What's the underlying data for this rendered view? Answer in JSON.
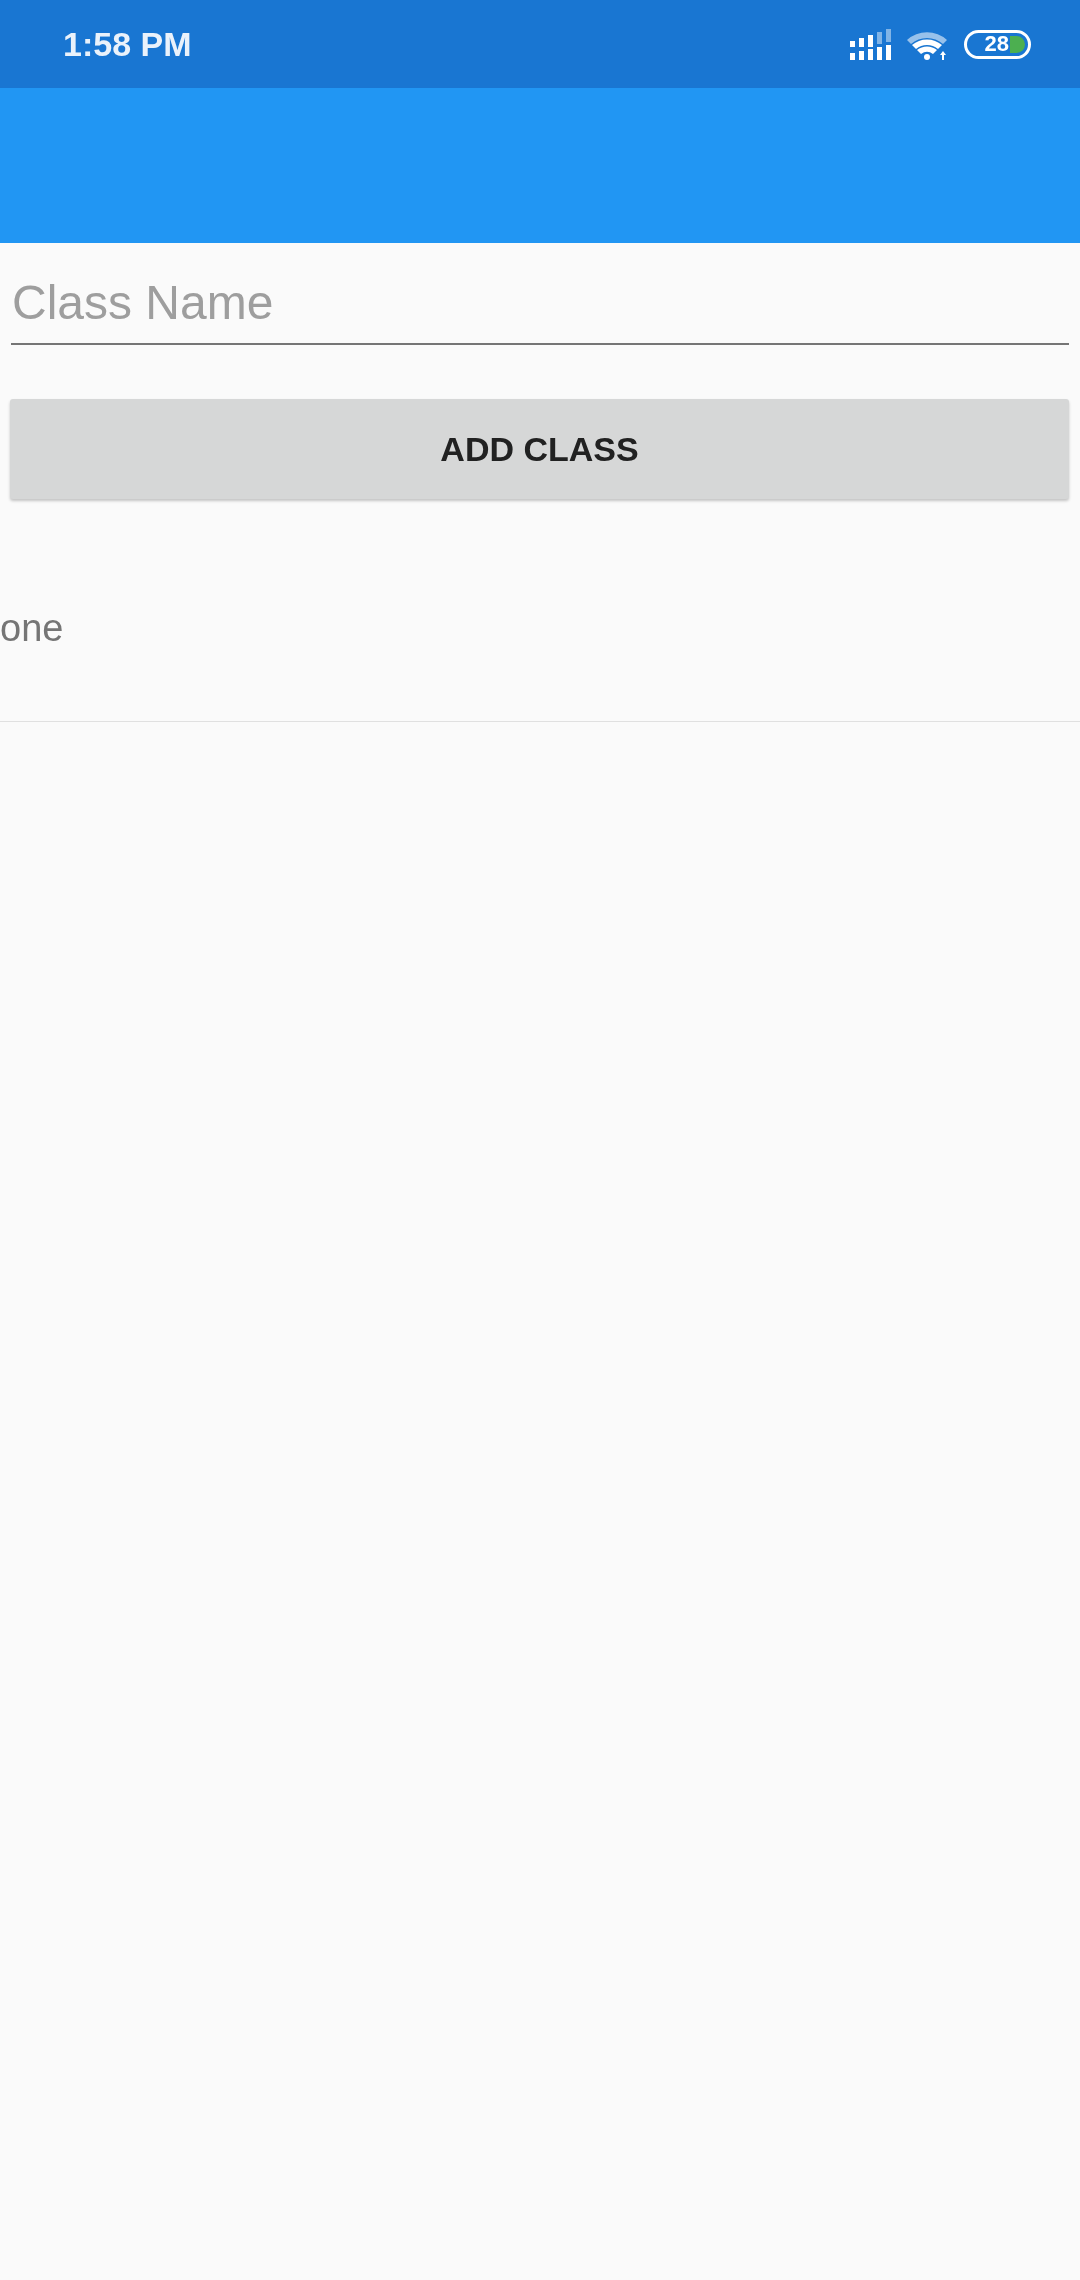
{
  "status_bar": {
    "time": "1:58 PM",
    "battery": "28"
  },
  "form": {
    "class_name": {
      "placeholder": "Class Name"
    },
    "add_button": {
      "label": "ADD CLASS"
    }
  },
  "classes": [
    {
      "name": "one"
    }
  ]
}
